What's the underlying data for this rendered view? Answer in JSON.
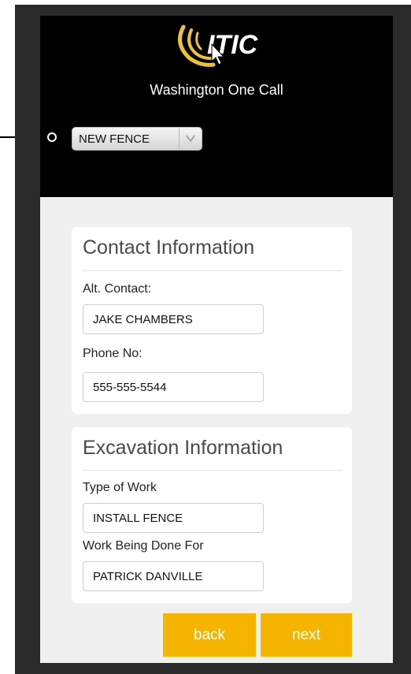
{
  "header": {
    "logo_text": "ITIC",
    "title": "Washington One Call",
    "type_select": {
      "value": "NEW FENCE",
      "icon": "chevron-down-icon"
    }
  },
  "contact": {
    "title": "Contact Information",
    "alt_contact_label": "Alt. Contact:",
    "alt_contact_value": "JAKE CHAMBERS",
    "phone_label": "Phone No:",
    "phone_value": "555-555-5544"
  },
  "excavation": {
    "title": "Excavation Information",
    "type_of_work_label": "Type of Work",
    "type_of_work_value": "INSTALL FENCE",
    "work_for_label": "Work Being Done For",
    "work_for_value": "PATRICK DANVILLE"
  },
  "actions": {
    "back_label": "back",
    "next_label": "next"
  },
  "colors": {
    "accent": "#f5b400",
    "logo_yellow": "#f1c232",
    "header_bg": "#000000",
    "content_bg": "#f0f0f0"
  }
}
